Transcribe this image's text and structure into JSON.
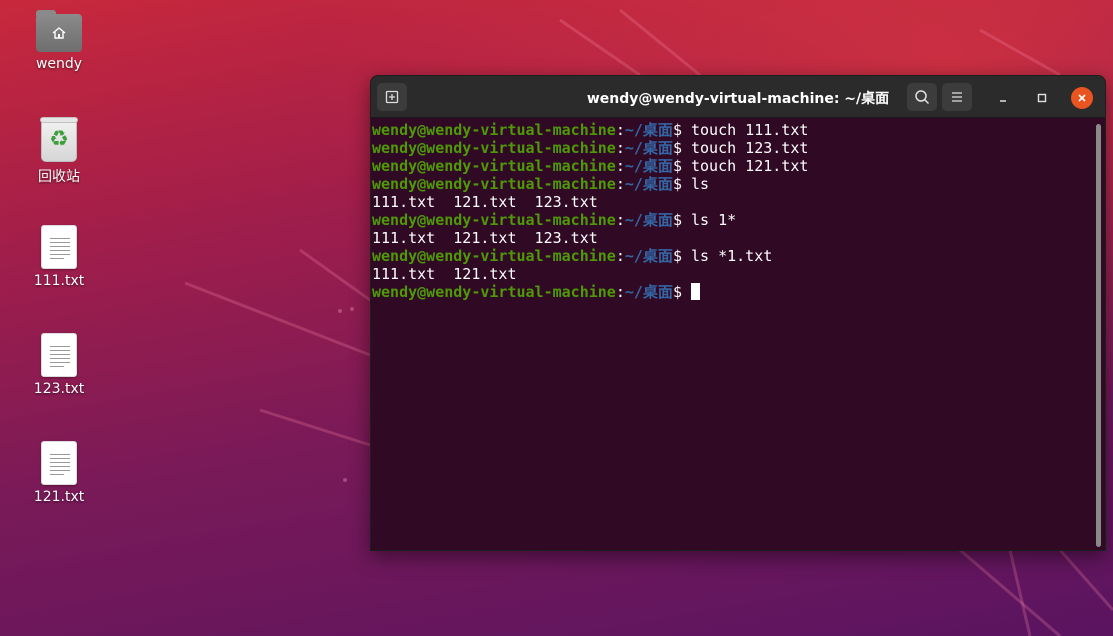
{
  "desktop": {
    "icons": [
      {
        "label": "wendy",
        "icon": "home-folder-icon"
      },
      {
        "label": "回收站",
        "icon": "trash-icon"
      },
      {
        "label": "111.txt",
        "icon": "text-file-icon"
      },
      {
        "label": "123.txt",
        "icon": "text-file-icon"
      },
      {
        "label": "121.txt",
        "icon": "text-file-icon"
      }
    ]
  },
  "terminal": {
    "title": "wendy@wendy-virtual-machine: ~/桌面",
    "prompt": {
      "user_host": "wendy@wendy-virtual-machine",
      "colon": ":",
      "path": "~/桌面",
      "symbol": "$ "
    },
    "lines": [
      {
        "type": "command",
        "text": "touch 111.txt"
      },
      {
        "type": "command",
        "text": "touch 123.txt"
      },
      {
        "type": "command",
        "text": "touch 121.txt"
      },
      {
        "type": "command",
        "text": "ls"
      },
      {
        "type": "output",
        "text": "111.txt  121.txt  123.txt"
      },
      {
        "type": "command",
        "text": "ls 1*"
      },
      {
        "type": "output",
        "text": "111.txt  121.txt  123.txt"
      },
      {
        "type": "command",
        "text": "ls *1.txt"
      },
      {
        "type": "output",
        "text": "111.txt  121.txt"
      },
      {
        "type": "prompt",
        "text": ""
      }
    ]
  },
  "colors": {
    "background": "#300a24",
    "prompt_user": "#4e9a06",
    "prompt_path": "#3465a4",
    "close_button": "#e95420"
  }
}
